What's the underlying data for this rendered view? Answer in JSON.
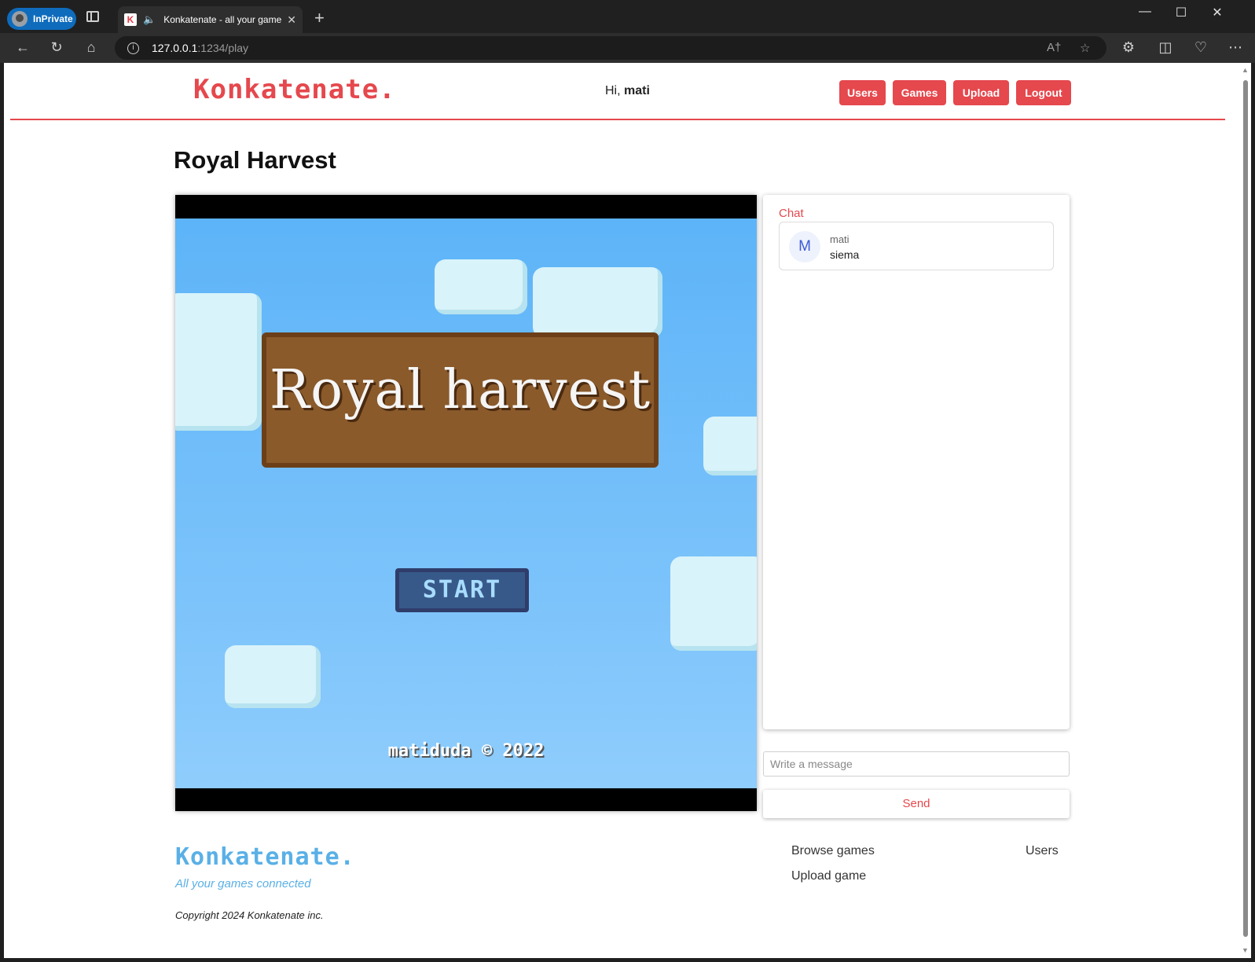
{
  "browser": {
    "inprivate_label": "InPrivate",
    "tab_title": "Konkatenate - all your game",
    "favicon_letter": "K",
    "url_host": "127.0.0.1",
    "url_path": ":1234/play"
  },
  "header": {
    "logo": "Konkatenate.",
    "greeting_prefix": "Hi, ",
    "username": "mati",
    "nav": [
      "Users",
      "Games",
      "Upload",
      "Logout"
    ]
  },
  "page": {
    "title": "Royal Harvest"
  },
  "game": {
    "banner_text": "Royal harvest",
    "start_label": "START",
    "copyright": "matiduda © 2022"
  },
  "chat": {
    "title": "Chat",
    "messages": [
      {
        "avatar_letter": "M",
        "author": "mati",
        "text": "siema"
      }
    ],
    "input_placeholder": "Write a message",
    "send_label": "Send"
  },
  "footer": {
    "logo": "Konkatenate.",
    "tagline": "All your games connected",
    "copyright": "Copyright 2024 Konkatenate inc.",
    "links": {
      "browse": "Browse games",
      "upload": "Upload game",
      "users": "Users"
    }
  },
  "colors": {
    "accent": "#e5484d",
    "footer_accent": "#5ab0e6",
    "sky": "#5db4f8"
  }
}
